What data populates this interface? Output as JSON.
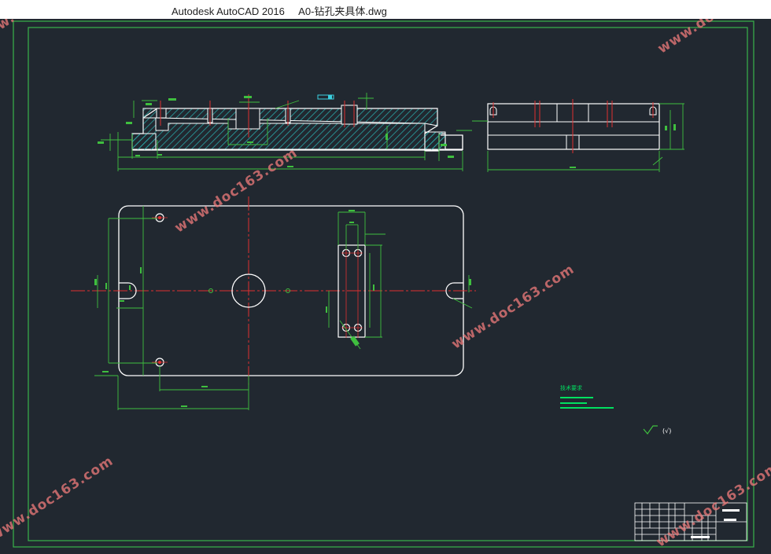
{
  "window": {
    "app_title": "Autodesk AutoCAD 2016",
    "file_title": "A0-钻孔夹具体.dwg"
  },
  "watermark": {
    "text": "www.doc163.com"
  },
  "drawing": {
    "colors": {
      "background": "#212830",
      "border": "#39b54a",
      "outline": "#ffffff",
      "dimension": "#3fbf3f",
      "centerline": "#e03030",
      "hatch": "#2aa6a6",
      "text_note": "#00e060"
    },
    "notes_heading": "技术要求",
    "roughness_label": "(√)"
  }
}
